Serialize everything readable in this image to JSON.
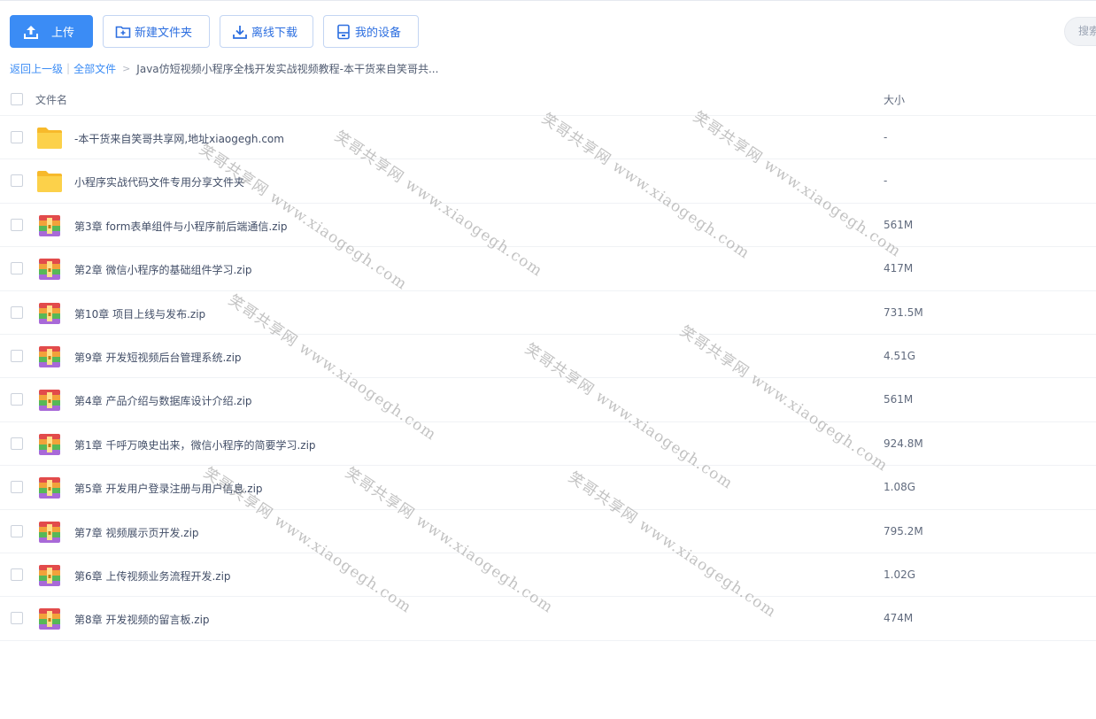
{
  "toolbar": {
    "upload_label": "上传",
    "new_folder_label": "新建文件夹",
    "offline_download_label": "离线下载",
    "my_devices_label": "我的设备"
  },
  "search": {
    "placeholder": "搜索"
  },
  "breadcrumb": {
    "back_label": "返回上一级",
    "all_files_label": "全部文件",
    "current": "Java仿短视频小程序全栈开发实战视频教程-本干货来自笑哥共..."
  },
  "table": {
    "col_name": "文件名",
    "col_size": "大小"
  },
  "files": [
    {
      "name": "-本干货来自笑哥共享网,地址xiaogegh.com",
      "size": "-",
      "type": "folder"
    },
    {
      "name": "小程序实战代码文件专用分享文件夹",
      "size": "-",
      "type": "folder"
    },
    {
      "name": "第3章 form表单组件与小程序前后端通信.zip",
      "size": "561M",
      "type": "zip"
    },
    {
      "name": "第2章 微信小程序的基础组件学习.zip",
      "size": "417M",
      "type": "zip"
    },
    {
      "name": "第10章 项目上线与发布.zip",
      "size": "731.5M",
      "type": "zip"
    },
    {
      "name": "第9章 开发短视频后台管理系统.zip",
      "size": "4.51G",
      "type": "zip"
    },
    {
      "name": "第4章 产品介绍与数据库设计介绍.zip",
      "size": "561M",
      "type": "zip"
    },
    {
      "name": "第1章 千呼万唤史出来，微信小程序的简要学习.zip",
      "size": "924.8M",
      "type": "zip"
    },
    {
      "name": "第5章 开发用户登录注册与用户信息.zip",
      "size": "1.08G",
      "type": "zip"
    },
    {
      "name": "第7章 视频展示页开发.zip",
      "size": "795.2M",
      "type": "zip"
    },
    {
      "name": "第6章 上传视频业务流程开发.zip",
      "size": "1.02G",
      "type": "zip"
    },
    {
      "name": "第8章 开发视频的留言板.zip",
      "size": "474M",
      "type": "zip"
    }
  ],
  "watermark_text": "笑哥共享网 www.xiaogegh.com",
  "colors": {
    "accent": "#3b8cf5",
    "folder": "#fbc83f"
  }
}
